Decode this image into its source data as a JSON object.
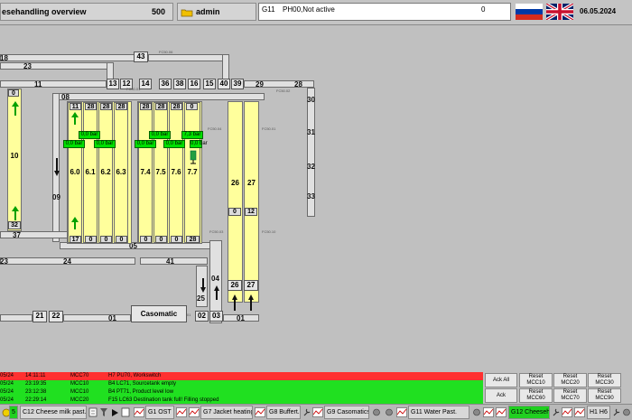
{
  "header": {
    "title": "esehandling overview",
    "title_num": "500",
    "user": "admin",
    "alarm_id": "G11",
    "alarm_text": "PH00,Not active",
    "alarm_count": "0",
    "date": "06.05.2024"
  },
  "pipes": {
    "p18": "18",
    "p23a": "23",
    "p43": "43",
    "p11a": "11",
    "p13": "13",
    "p12": "12",
    "p14": "14",
    "p36": "36",
    "p38": "38",
    "p16": "16",
    "p15": "15",
    "p40": "40",
    "p39": "39",
    "p29": "29",
    "p28": "28",
    "p30": "30",
    "p31": "31",
    "p32": "32",
    "p33": "33",
    "p09": "09",
    "p37": "37",
    "p05": "05",
    "p23b": "23",
    "p24": "24",
    "p41": "41",
    "p25": "25",
    "p04": "04",
    "p02": "02",
    "p03": "03",
    "p01a": "01",
    "p01b": "01",
    "p21": "21",
    "p22": "22",
    "p08": "08",
    "casomatic": "Casomatic",
    "fc1": "FC50.06",
    "fc2": "FC50.01",
    "fc3": "FC50.02",
    "fc4": "FC50.04",
    "fc5": "FC50.01",
    "fc6": "FC50.03",
    "fc7": "FC50.10",
    "fc8": "FC50.03",
    "fc9": "FC50.01"
  },
  "tanks": {
    "t10": {
      "label": "10",
      "top": "0",
      "bottom": "32"
    },
    "t60": {
      "label": "6.0",
      "top": "11",
      "bottom": "17"
    },
    "t61": {
      "label": "6.1",
      "top": "28",
      "bottom": "0"
    },
    "t62": {
      "label": "6.2",
      "top": "28",
      "bottom": "0"
    },
    "t63": {
      "label": "6.3",
      "top": "28",
      "bottom": "0"
    },
    "t74": {
      "label": "7.4",
      "top": "28",
      "bottom": "0"
    },
    "t75": {
      "label": "7.5",
      "top": "28",
      "bottom": "0"
    },
    "t76": {
      "label": "7.6",
      "top": "28",
      "bottom": "0"
    },
    "t77": {
      "label": "7.7",
      "top": "0",
      "bottom": "28"
    },
    "t26": {
      "label": "26",
      "mid": "0",
      "bottom": "26"
    },
    "t27": {
      "label": "27",
      "mid": "12",
      "bottom": "27"
    }
  },
  "pressures": [
    "0,0 bar",
    "0,0 bar",
    "0,0 bar",
    "0,0 bar",
    "0,0 bar",
    "0,0 bar",
    "0,0 bar",
    "7,3 bar"
  ],
  "alarms": [
    {
      "date": "05/24",
      "time": "14:11:11",
      "unit": "MCC70",
      "text": "H7 PU70, Workswitch",
      "color": "red"
    },
    {
      "date": "05/24",
      "time": "23:19:35",
      "unit": "MCC10",
      "text": "B4 LC71, Sourcetank empty",
      "color": "green"
    },
    {
      "date": "05/24",
      "time": "23:12:38",
      "unit": "MCC10",
      "text": "B4 PT71, Product level low",
      "color": "green"
    },
    {
      "date": "05/24",
      "time": "22:29:14",
      "unit": "MCC20",
      "text": "F15 LC63 Destination tank full! Filling stopped",
      "color": "green"
    }
  ],
  "ack": {
    "ack_all": "Ack All",
    "ack": "Ack"
  },
  "reset": [
    {
      "l1": "Reset",
      "l2": "MCC10"
    },
    {
      "l1": "Reset",
      "l2": "MCC20"
    },
    {
      "l1": "Reset",
      "l2": "MCC30"
    },
    {
      "l1": "Reset",
      "l2": "MCC60"
    },
    {
      "l1": "Reset",
      "l2": "MCC70"
    },
    {
      "l1": "Reset",
      "l2": "MCC90"
    }
  ],
  "taskbar": {
    "num": "5",
    "c12": "C12 Cheese milk past.",
    "g1": "G1 OST",
    "g7": "G7 Jacket heating",
    "g8": "G8 Buffert.",
    "g9": "G9 Casomaticsc",
    "g11": "G11 Water Past.",
    "g12": "G12 Cheeseh.",
    "h1": "H1 H6"
  },
  "colors": {
    "tank": "#ffff9c",
    "alarm_red": "#ff3030",
    "alarm_green": "#20e020",
    "bar_green": "#00e000"
  }
}
